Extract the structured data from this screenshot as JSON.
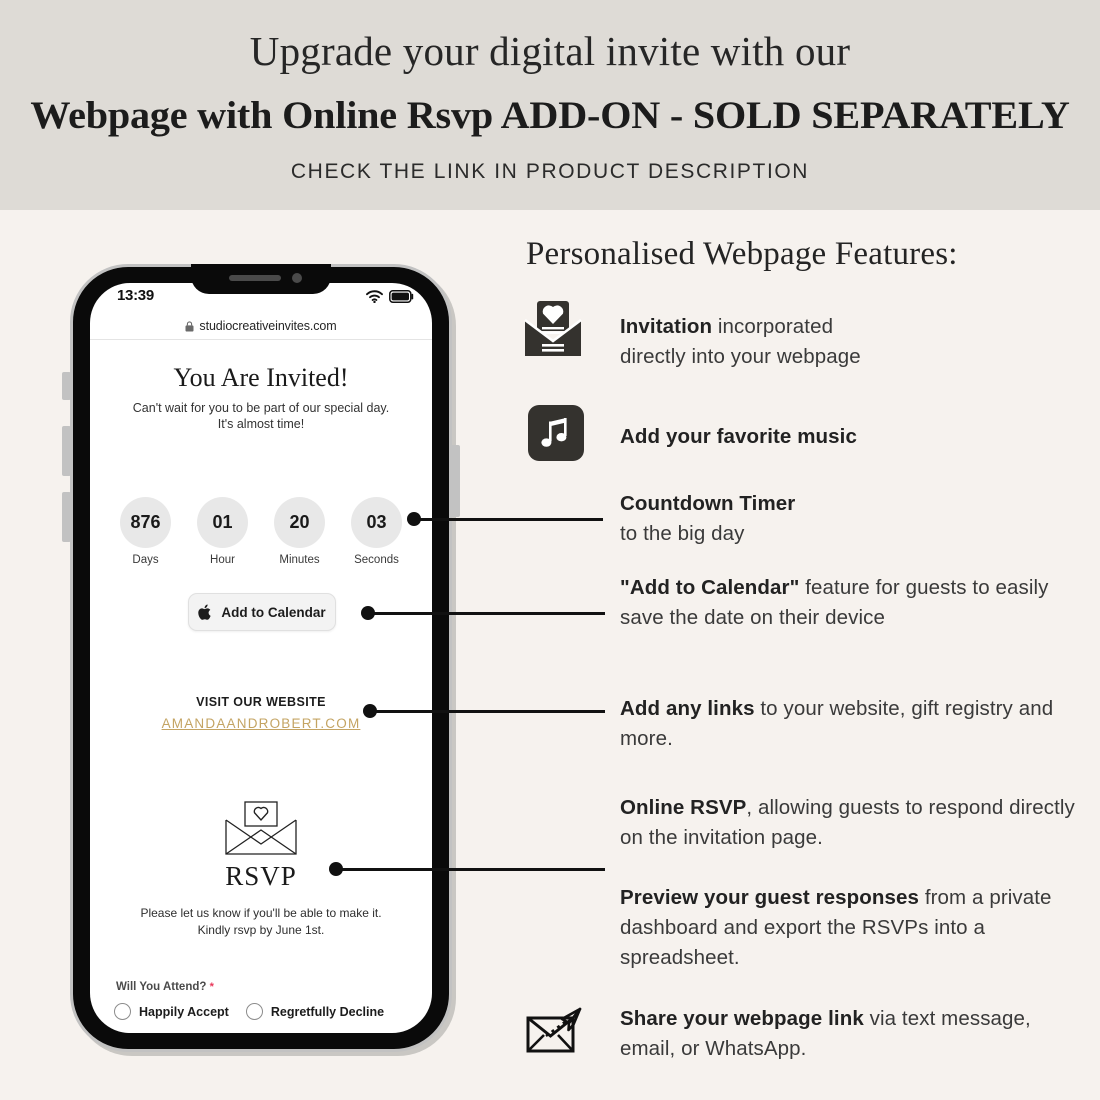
{
  "header": {
    "line1": "Upgrade your digital invite with our",
    "line2": "Webpage with Online Rsvp ADD-ON - SOLD SEPARATELY",
    "line3": "CHECK THE LINK IN PRODUCT DESCRIPTION",
    "band_color": "#dedbd6"
  },
  "page": {
    "background_color": "#f6f2ee",
    "accent_gold": "#c4a463",
    "ink": "#111111"
  },
  "features": {
    "title": "Personalised Webpage Features:",
    "items": [
      {
        "icon": "invitation-envelope-icon",
        "bold": "Invitation",
        "rest": " incorporated directly into your webpage"
      },
      {
        "icon": "music-note-icon",
        "bold": "Add your favorite music",
        "rest": ""
      },
      {
        "icon": "",
        "bold": "Countdown Timer",
        "rest": "\nto the big day"
      },
      {
        "icon": "",
        "bold": "\"Add to Calendar\"",
        "rest": " feature for guests to easily save the date on their device"
      },
      {
        "icon": "",
        "bold": "Add any links",
        "rest": " to your website, gift registry and more."
      },
      {
        "icon": "",
        "bold": "Online RSVP",
        "rest": ", allowing guests to respond directly on the invitation page."
      },
      {
        "icon": "",
        "bold": "Preview your guest responses",
        "rest": " from a private dashboard and export the RSVPs into a spreadsheet."
      },
      {
        "icon": "share-envelope-icon",
        "bold": "Share your webpage link",
        "rest": " via text message, email, or WhatsApp."
      }
    ],
    "invitation_bold": "Invitation",
    "invitation_rest_1": " incorporated",
    "invitation_rest_2": "directly into your webpage",
    "music_bold": "Add your favorite music",
    "countdown_bold": "Countdown Timer",
    "countdown_rest": "to the big day",
    "calendar_bold": "\"Add to Calendar\"",
    "calendar_rest": " feature for guests to easily save the date on their device",
    "links_bold": "Add any links",
    "links_rest": " to your website, gift registry and more.",
    "rsvp_bold": "Online RSVP",
    "rsvp_rest": ", allowing guests to respond directly on the invitation page.",
    "preview_bold": "Preview your guest responses",
    "preview_rest": " from  a private dashboard and export the RSVPs into a spreadsheet.",
    "share_bold": "Share your webpage link",
    "share_rest": " via text message, email, or WhatsApp."
  },
  "phone": {
    "status": {
      "time": "13:39"
    },
    "browser": {
      "url": "studiocreativeinvites.com"
    },
    "invite": {
      "title": "You Are Invited!",
      "subtitle_line1": "Can't wait for you to be part of our special day.",
      "subtitle_line2": "It's almost time!"
    },
    "countdown": [
      {
        "value": "876",
        "label": "Days"
      },
      {
        "value": "01",
        "label": "Hour"
      },
      {
        "value": "20",
        "label": "Minutes"
      },
      {
        "value": "03",
        "label": "Seconds"
      }
    ],
    "calendar_button": {
      "label": "Add to Calendar",
      "icon": "apple-logo-icon"
    },
    "website": {
      "label": "VISIT OUR WEBSITE",
      "link": "AMANDAANDROBERT.COM"
    },
    "rsvp": {
      "title": "RSVP",
      "sub_line1": "Please let us know if you'll be able to make it.",
      "sub_line2": "Kindly rsvp by June 1st.",
      "question": "Will You Attend?",
      "required_mark": "*",
      "options": [
        "Happily Accept",
        "Regretfully Decline"
      ]
    }
  }
}
